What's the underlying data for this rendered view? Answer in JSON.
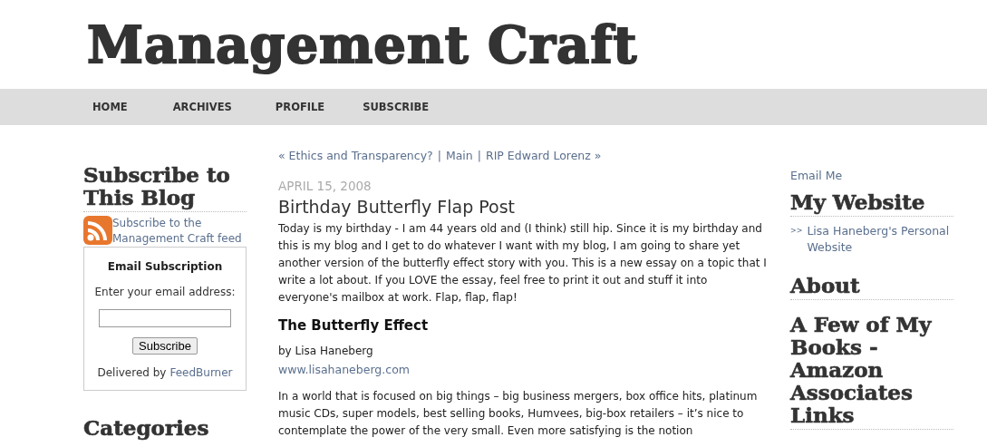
{
  "site": {
    "title": "Management Craft"
  },
  "nav": [
    "HOME",
    "ARCHIVES",
    "PROFILE",
    "SUBSCRIBE"
  ],
  "left": {
    "heading": "Subscribe to This Blog",
    "feed_link": "Subscribe to the Management Craft feed",
    "email_box": {
      "title": "Email Subscription",
      "prompt": "Enter your email address:",
      "button": "Subscribe",
      "delivered_by": "Delivered by",
      "provider": "FeedBurner"
    },
    "next_heading": "Categories"
  },
  "post": {
    "prev_link": "« Ethics and Transparency?",
    "separators": [
      "|",
      "|"
    ],
    "main_link": "Main",
    "next_link": "RIP Edward Lorenz »",
    "date": "APRIL 15, 2008",
    "title": "Birthday Butterfly Flap Post",
    "intro": "Today is my birthday - I am 44 years old and (I think) still hip. Since it is my birthday and this is my blog and I get to do whatever I want with my blog, I am going to share yet another version of the butterfly effect story with you. This is a new essay on a topic that I write a lot about. If you LOVE the essay, feel free to print it out and stuff it into everyone's mailbox at work. Flap, flap, flap!",
    "subheading": "The Butterfly Effect",
    "byline": "by Lisa Haneberg",
    "website": "www.lisahaneberg.com",
    "body": "In a world that is focused on big things – big business mergers, box office hits, platinum music CDs, super models, best selling books, Humvees, big-box retailers – it’s nice to contemplate the power of the very small. Even more satisfying is the notion"
  },
  "right": {
    "email_link": "Email Me",
    "website_heading": "My Website",
    "website_marker": ">>",
    "website_link": "Lisa Haneberg's Personal Website",
    "about_heading": "About",
    "books_heading": "A Few of My Books - Amazon Associates Links"
  }
}
